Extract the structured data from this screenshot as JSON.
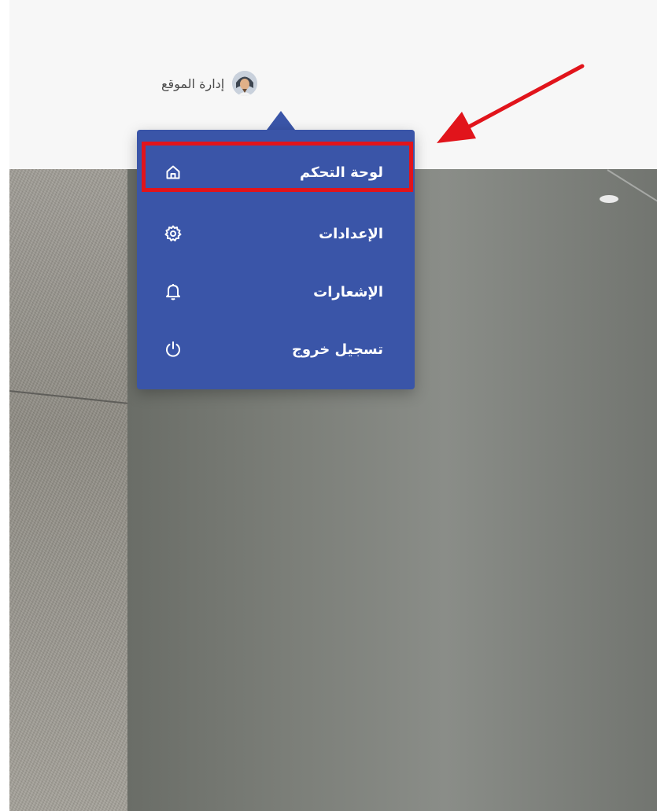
{
  "user": {
    "name": "إدارة الموقع",
    "avatar_icon": "user-avatar"
  },
  "menu": {
    "background_color": "#3a55a8",
    "items": [
      {
        "label": "لوحة التحكم",
        "icon": "home-icon",
        "highlighted": true
      },
      {
        "label": "الإعدادات",
        "icon": "gear-icon",
        "highlighted": false
      },
      {
        "label": "الإشعارات",
        "icon": "bell-icon",
        "highlighted": false
      },
      {
        "label": "تسجيل خروج",
        "icon": "power-icon",
        "highlighted": false
      }
    ]
  },
  "annotation": {
    "highlight_color": "#e1141b",
    "arrow_color": "#e1141b",
    "arrow_target": "menu.items.0"
  }
}
